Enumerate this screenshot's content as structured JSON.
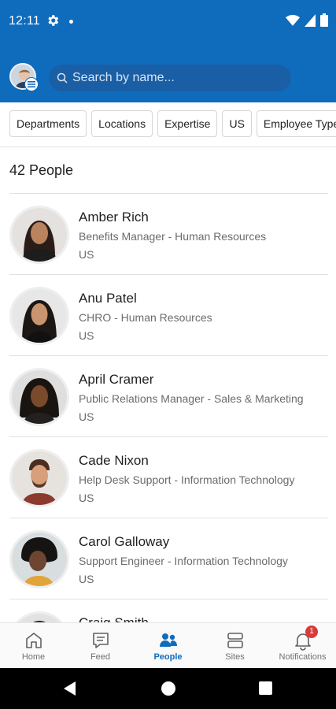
{
  "status_bar": {
    "time": "12:11"
  },
  "search": {
    "placeholder": "Search by name..."
  },
  "filters": [
    "Departments",
    "Locations",
    "Expertise",
    "US",
    "Employee Type"
  ],
  "people_count": "42 People",
  "people": [
    {
      "name": "Amber Rich",
      "title": "Benefits Manager - Human Resources",
      "location": "US"
    },
    {
      "name": "Anu Patel",
      "title": "CHRO - Human Resources",
      "location": "US"
    },
    {
      "name": "April Cramer",
      "title": "Public Relations Manager - Sales & Marketing",
      "location": "US"
    },
    {
      "name": "Cade Nixon",
      "title": "Help Desk Support - Information Technology",
      "location": "US"
    },
    {
      "name": "Carol Galloway",
      "title": "Support Engineer - Information Technology",
      "location": "US"
    },
    {
      "name": "Craig Smith"
    }
  ],
  "bottom_nav": [
    {
      "label": "Home",
      "icon": "home-icon"
    },
    {
      "label": "Feed",
      "icon": "feed-icon"
    },
    {
      "label": "People",
      "icon": "people-icon",
      "active": true
    },
    {
      "label": "Sites",
      "icon": "sites-icon"
    },
    {
      "label": "Notifications",
      "icon": "bell-icon",
      "badge": "1"
    }
  ],
  "colors": {
    "brand": "#0f6cbd",
    "badge": "#d83b3b"
  }
}
